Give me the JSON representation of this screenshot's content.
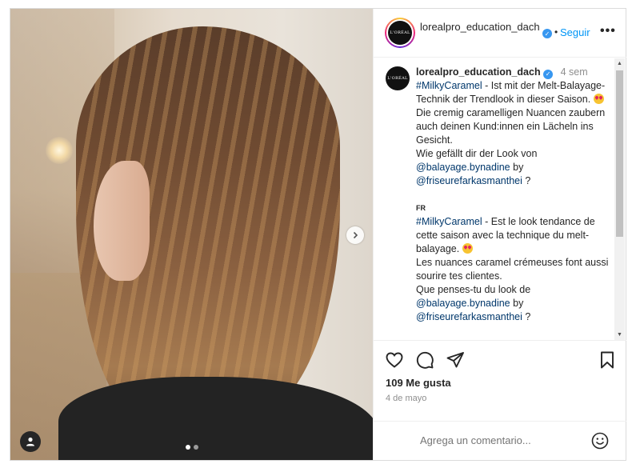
{
  "post": {
    "photo": {
      "carousel_total": 2,
      "carousel_active": 1,
      "icons": {
        "next": "chevron-right-icon",
        "tag": "user-tag-icon"
      }
    },
    "header": {
      "username": "lorealpro_education_dach",
      "separator": "•",
      "follow_label": "Seguir",
      "more_label": "•••",
      "logo_text": "L'ORÉAL"
    },
    "caption": {
      "username": "lorealpro_education_dach",
      "time": "4 sem",
      "de": {
        "hashtag": "#MilkyCaramel",
        "line1": " - Ist mit der Melt-Balayage-Technik der Trendlook in dieser Saison. ",
        "line2": "Die cremig caramelligen Nuancen zaubern auch deinen Kund:innen ein Lächeln ins Gesicht.",
        "line3": "Wie gefällt dir der Look von",
        "mention1": "@balayage.bynadine",
        "by": " by",
        "mention2": "@friseurefarkasmanthei",
        "end": " ?"
      },
      "fr": {
        "lang": "FR",
        "hashtag": "#MilkyCaramel",
        "line1": " - Est le look tendance de cette saison avec la technique du melt-balayage. ",
        "line2": "Les nuances caramel crémeuses font aussi sourire tes clientes.",
        "line3": "Que penses-tu du look de",
        "mention1": "@balayage.bynadine",
        "by": " by",
        "mention2": "@friseurefarkasmanthei",
        "end": " ?"
      }
    },
    "actions": {
      "likes": "109 Me gusta",
      "date": "4 de mayo",
      "icons": [
        "heart-icon",
        "comment-icon",
        "share-icon",
        "bookmark-icon"
      ]
    },
    "comment_box": {
      "placeholder": "Agrega un comentario...",
      "emoji_icon": "smiley-icon"
    },
    "colors": {
      "accent": "#0095f6",
      "verified": "#3897f0",
      "link": "#00376b",
      "muted": "#8e8e8e"
    }
  }
}
